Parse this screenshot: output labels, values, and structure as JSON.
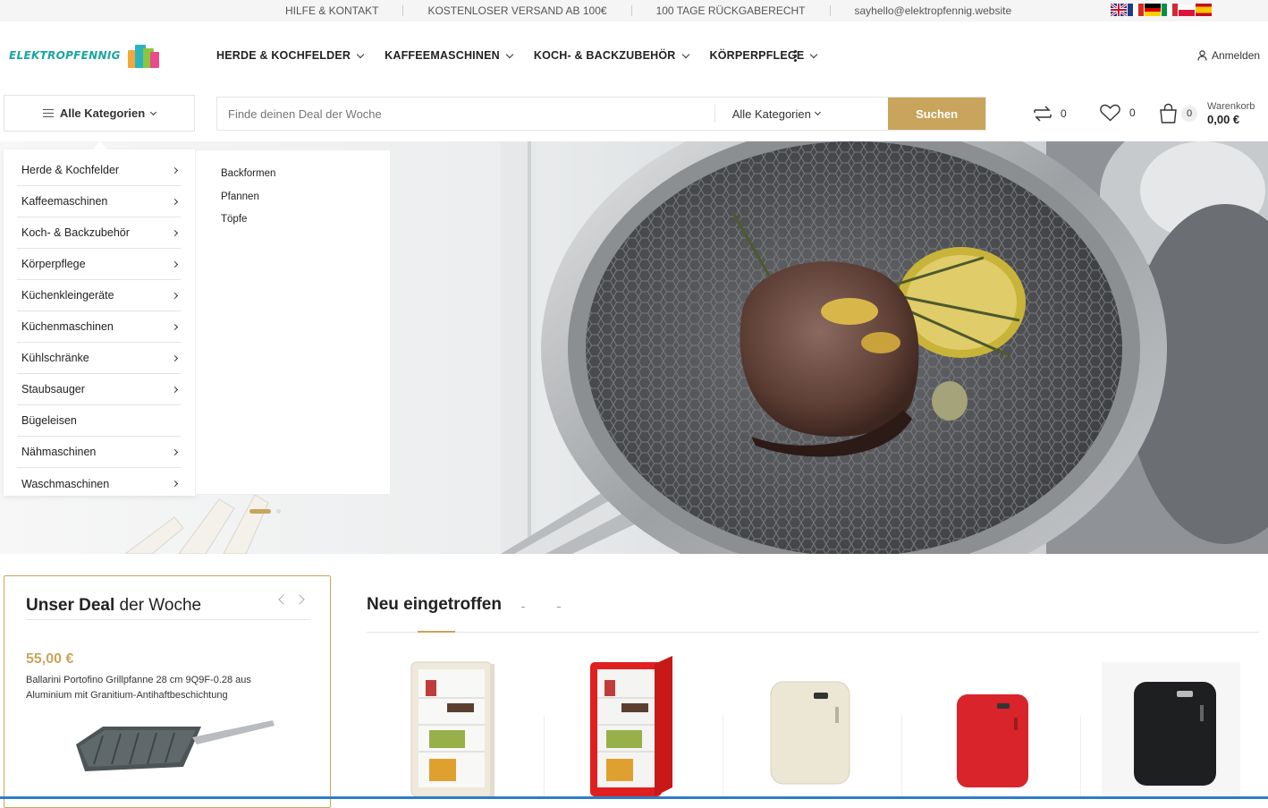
{
  "topbar": {
    "links": [
      "HILFE & KONTAKT",
      "KOSTENLOSER VERSAND AB 100€",
      "100 TAGE RÜCKGABERECHT",
      "sayhello@elektropfennig.website"
    ],
    "languages": [
      "en",
      "fr",
      "de",
      "it",
      "pl",
      "es"
    ]
  },
  "header": {
    "logo_text": "ELEKTROPFENNIG",
    "nav": [
      "HERDE & KOCHFELDER",
      "KAFFEEMASCHINEN",
      "KOCH- & BACKZUBEHÖR",
      "KÖRPERPFLEGE"
    ],
    "more_icon": "vertical-dots-icon",
    "login_label": "Anmelden"
  },
  "searchbar": {
    "all_categories": "Alle Kategorien",
    "placeholder": "Finde deinen Deal der Woche",
    "category_select": "Alle Kategorien",
    "button": "Suchen"
  },
  "header_icons": {
    "compare_count": "0",
    "wishlist_count": "0",
    "cart_count": "0",
    "cart_label": "Warenkorb",
    "cart_total": "0,00 €"
  },
  "category_menu": {
    "items": [
      {
        "label": "Herde & Kochfelder",
        "has_sub": true
      },
      {
        "label": "Kaffeemaschinen",
        "has_sub": true
      },
      {
        "label": "Koch- & Backzubehör",
        "has_sub": true
      },
      {
        "label": "Körperpflege",
        "has_sub": true
      },
      {
        "label": "Küchenkleingeräte",
        "has_sub": true
      },
      {
        "label": "Küchenmaschinen",
        "has_sub": true
      },
      {
        "label": "Kühlschränke",
        "has_sub": true
      },
      {
        "label": "Staubsauger",
        "has_sub": true
      },
      {
        "label": "Bügeleisen",
        "has_sub": false
      },
      {
        "label": "Nähmaschinen",
        "has_sub": true
      },
      {
        "label": "Waschmaschinen",
        "has_sub": true
      }
    ],
    "submenu": [
      "Backformen",
      "Pfannen",
      "Töpfe"
    ]
  },
  "hero": {
    "slide_count": 2,
    "active_slide": 1
  },
  "deal": {
    "title_bold": "Unser Deal",
    "title_rest": " der Woche",
    "price": "55,00 €",
    "description": "Ballarini Portofino Grillpfanne 28 cm 9Q9F-0.28 aus Aluminium mit Granitium-Antihaftbeschichtung"
  },
  "new_arrivals": {
    "title": "Neu eingetroffen",
    "products": [
      {
        "image": "cream-fridge-open"
      },
      {
        "image": "red-fridge-open"
      },
      {
        "image": "cream-retro-fridge"
      },
      {
        "image": "red-retro-fridge"
      },
      {
        "image": "black-retro-fridge"
      }
    ]
  },
  "colors": {
    "accent": "#c9a45c",
    "logo": "#1aa6a0"
  }
}
